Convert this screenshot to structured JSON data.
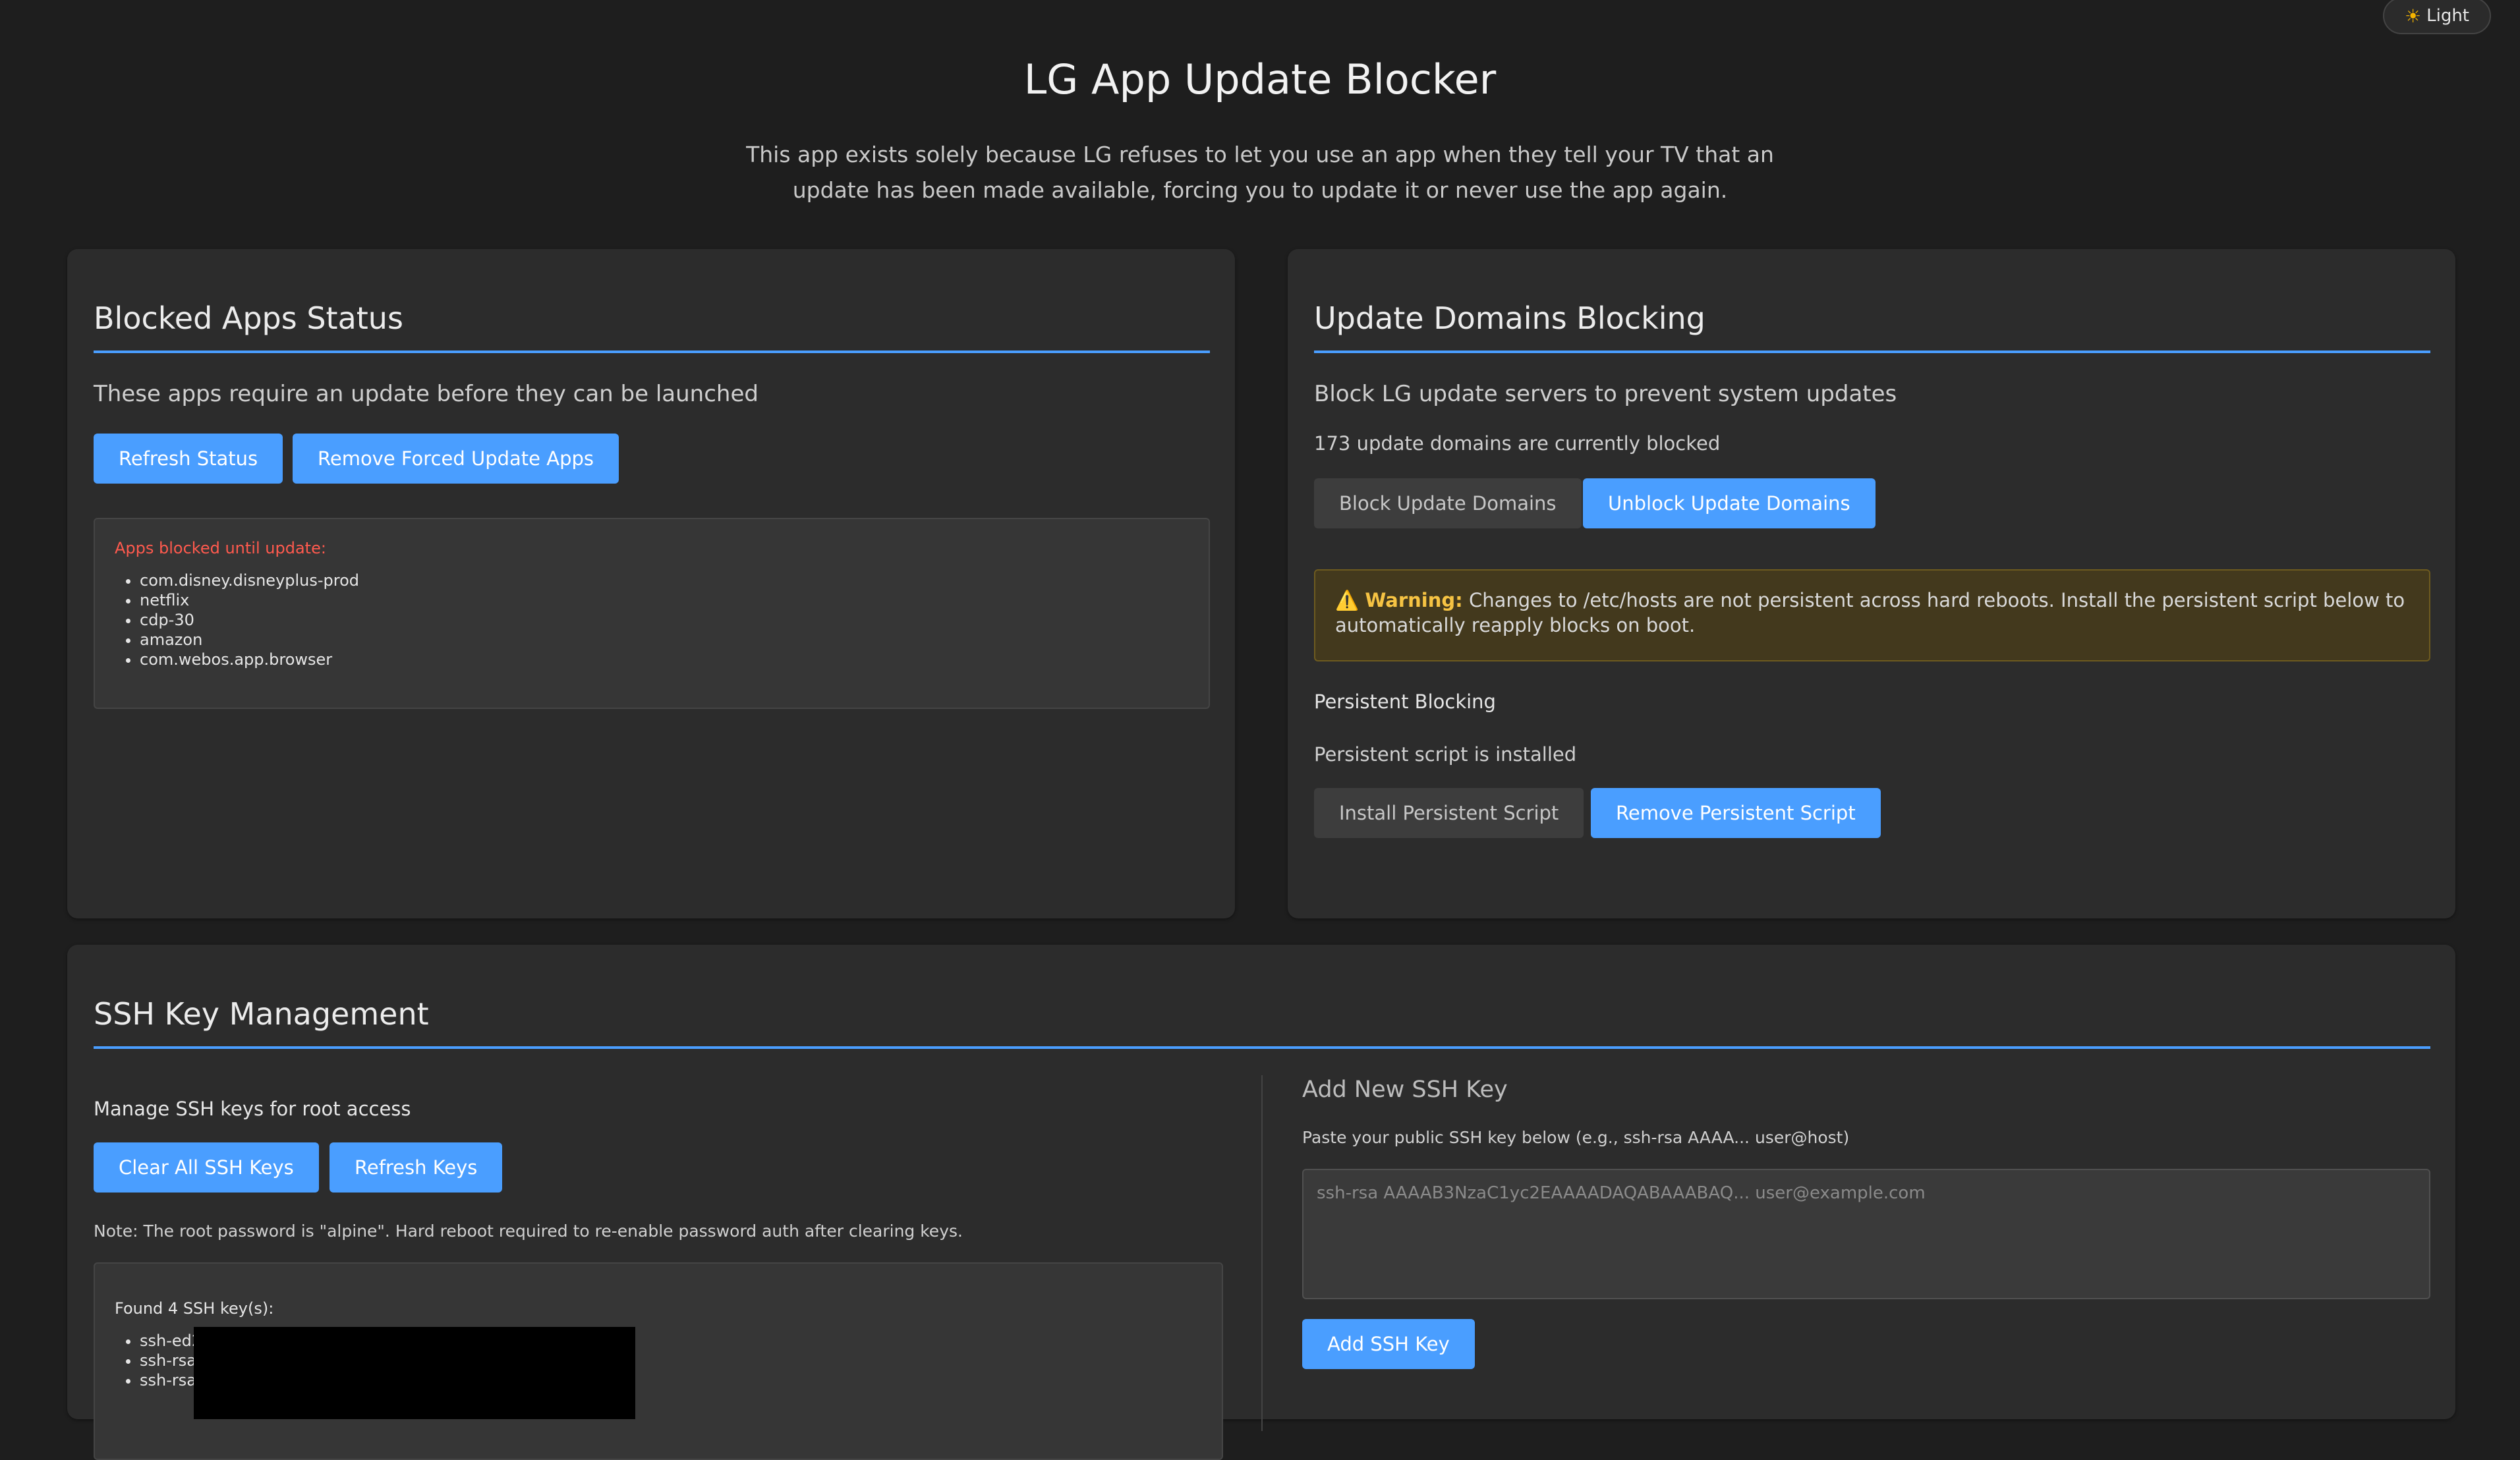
{
  "header": {
    "theme_toggle_label": "Light",
    "title": "LG App Update Blocker",
    "subtitle": "This app exists solely because LG refuses to let you use an app when they tell your TV that an update has been made available, forcing you to update it or never use the app again."
  },
  "blocked_apps": {
    "title": "Blocked Apps Status",
    "description": "These apps require an update before they can be launched",
    "refresh_button": "Refresh Status",
    "remove_button": "Remove Forced Update Apps",
    "list_label": "Apps blocked until update:",
    "apps": [
      "com.disney.disneyplus-prod",
      "netflix",
      "cdp-30",
      "amazon",
      "com.webos.app.browser"
    ]
  },
  "update_domains": {
    "title": "Update Domains Blocking",
    "description": "Block LG update servers to prevent system updates",
    "status": "173 update domains are currently blocked",
    "block_button": "Block Update Domains",
    "unblock_button": "Unblock Update Domains",
    "warning_label": "Warning:",
    "warning_text": "Changes to /etc/hosts are not persistent across hard reboots. Install the persistent script below to automatically reapply blocks on boot.",
    "persistent_heading": "Persistent Blocking",
    "persistent_status": "Persistent script is installed",
    "install_button": "Install Persistent Script",
    "remove_button": "Remove Persistent Script"
  },
  "ssh": {
    "title": "SSH Key Management",
    "description": "Manage SSH keys for root access",
    "clear_button": "Clear All SSH Keys",
    "refresh_button": "Refresh Keys",
    "note": "Note: The root password is \"alpine\". Hard reboot required to re-enable password auth after clearing keys.",
    "found_label": "Found 4 SSH key(s):",
    "keys": [
      "ssh-ed2",
      "ssh-rsa",
      "ssh-rsa"
    ],
    "add_title": "Add New SSH Key",
    "add_instructions": "Paste your public SSH key below (e.g., ssh-rsa AAAA... user@host)",
    "add_placeholder": "ssh-rsa AAAAB3NzaC1yc2EAAAADAQABAAABAQ... user@example.com",
    "add_button": "Add SSH Key"
  },
  "colors": {
    "accent": "#4a9eff",
    "success": "#44c35a",
    "error": "#ff5a4e",
    "warning": "#f6c343"
  }
}
